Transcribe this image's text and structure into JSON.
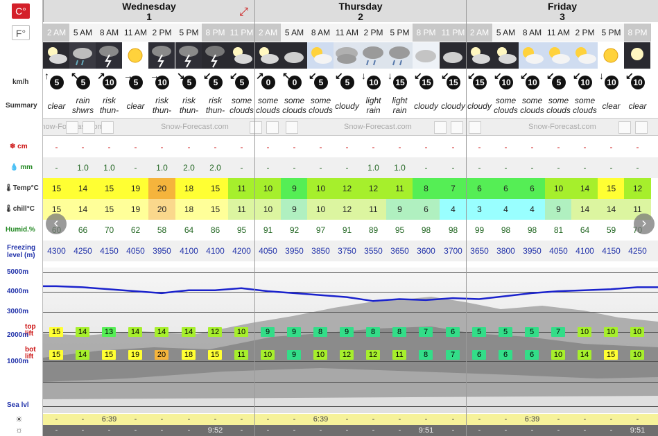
{
  "units": {
    "celsius": "C°",
    "fahrenheit": "F°"
  },
  "row_labels": {
    "speed": "km/h",
    "summary": "Summary",
    "snow": "cm",
    "rain": "mm",
    "temp": "Temp°C",
    "chill": "chill°C",
    "humid": "Humid.%",
    "freezing_1": "Freezing",
    "freezing_2": "level (m)",
    "alt_5000": "5000m",
    "alt_4000": "4000m",
    "alt_3000": "3000m",
    "alt_2000": "2000m",
    "alt_1000": "1000m",
    "sea": "Sea lvl",
    "top_lift_1": "top",
    "top_lift_2": "lift",
    "bot_lift_1": "bot",
    "bot_lift_2": "lift"
  },
  "days": [
    {
      "name": "Wednesday",
      "num": "1"
    },
    {
      "name": "Thursday",
      "num": "2"
    },
    {
      "name": "Friday",
      "num": "3"
    }
  ],
  "times": [
    "2 AM",
    "5 AM",
    "8 AM",
    "11 AM",
    "2 PM",
    "5 PM",
    "8 PM",
    "11 PM",
    "2 AM",
    "5 AM",
    "8 AM",
    "11 AM",
    "2 PM",
    "5 PM",
    "8 PM",
    "11 PM",
    "2 AM",
    "5 AM",
    "8 AM",
    "11 AM",
    "2 PM",
    "5 PM",
    "8 PM"
  ],
  "night": [
    true,
    false,
    false,
    false,
    false,
    false,
    true,
    true,
    true,
    false,
    false,
    false,
    false,
    false,
    true,
    true,
    true,
    false,
    false,
    false,
    false,
    false,
    true
  ],
  "icons": [
    "moon-cloud",
    "rain-cloud",
    "thunder",
    "sun",
    "thunder",
    "thunder",
    "thunder-night",
    "moon-cloud",
    "moon-cloud",
    "cloud-night",
    "sun-cloud",
    "heavy-cloud",
    "rain-cloud-day",
    "rain-cloud-day",
    "cloud",
    "cloud-night",
    "moon-cloud",
    "moon-cloud",
    "sun-cloud",
    "sun-cloud",
    "sun-cloud",
    "sun",
    "moon"
  ],
  "wind_speed": [
    "5",
    "5",
    "10",
    "5",
    "10",
    "5",
    "5",
    "5",
    "0",
    "0",
    "5",
    "5",
    "10",
    "15",
    "15",
    "15",
    "15",
    "10",
    "10",
    "5",
    "10",
    "10",
    "10"
  ],
  "wind_dir": [
    "↑",
    "↖",
    "↗",
    "→",
    "→",
    "↘",
    "↙",
    "↙",
    "↗",
    "↖",
    "↙",
    "↙",
    "↓",
    "↓",
    "↙",
    "↙",
    "↙",
    "↙",
    "↙",
    "↙",
    "↙",
    "↓",
    "↙"
  ],
  "summary": [
    [
      "clear"
    ],
    [
      "rain",
      "shwrs"
    ],
    [
      "risk",
      "thun-"
    ],
    [
      "clear"
    ],
    [
      "risk",
      "thun-"
    ],
    [
      "risk",
      "thun-"
    ],
    [
      "risk",
      "thun-"
    ],
    [
      "some",
      "clouds"
    ],
    [
      "some",
      "clouds"
    ],
    [
      "some",
      "clouds"
    ],
    [
      "some",
      "clouds"
    ],
    [
      "cloudy"
    ],
    [
      "light",
      "rain"
    ],
    [
      "light",
      "rain"
    ],
    [
      "cloudy"
    ],
    [
      "cloudy"
    ],
    [
      "cloudy"
    ],
    [
      "some",
      "clouds"
    ],
    [
      "some",
      "clouds"
    ],
    [
      "some",
      "clouds"
    ],
    [
      "some",
      "clouds"
    ],
    [
      "clear"
    ],
    [
      "clear"
    ]
  ],
  "ad_text": "Snow-Forecast.com",
  "snow": [
    "-",
    "-",
    "-",
    "-",
    "-",
    "-",
    "-",
    "-",
    "-",
    "-",
    "-",
    "-",
    "-",
    "-",
    "-",
    "-",
    "-",
    "-",
    "-",
    "-",
    "-",
    "-",
    "-"
  ],
  "rain": [
    "-",
    "1.0",
    "1.0",
    "-",
    "1.0",
    "2.0",
    "2.0",
    "-",
    "-",
    "-",
    "-",
    "-",
    "1.0",
    "1.0",
    "-",
    "-",
    "-",
    "-",
    "-",
    "-",
    "-",
    "-",
    "-"
  ],
  "temp": [
    "15",
    "14",
    "15",
    "19",
    "20",
    "18",
    "15",
    "11",
    "10",
    "9",
    "10",
    "12",
    "12",
    "11",
    "8",
    "7",
    "6",
    "6",
    "6",
    "10",
    "14",
    "15",
    "12"
  ],
  "temp_colors": [
    "#ffff33",
    "#ffff33",
    "#ffff33",
    "#ffff33",
    "#f5b43c",
    "#ffff33",
    "#ffff33",
    "#a6ef2c",
    "#a6ef2c",
    "#55ee55",
    "#a6ef2c",
    "#a6ef2c",
    "#a6ef2c",
    "#a6ef2c",
    "#55ee55",
    "#55ee55",
    "#55ee55",
    "#55ee55",
    "#55ee55",
    "#a6ef2c",
    "#a6ef2c",
    "#ffff33",
    "#a6ef2c"
  ],
  "chill": [
    "15",
    "14",
    "15",
    "19",
    "20",
    "18",
    "15",
    "11",
    "10",
    "9",
    "10",
    "12",
    "11",
    "9",
    "6",
    "4",
    "3",
    "4",
    "4",
    "9",
    "14",
    "14",
    "11"
  ],
  "chill_colors": [
    "#ffff99",
    "#ffff99",
    "#ffff99",
    "#ffff99",
    "#fad88c",
    "#ffff99",
    "#ffff99",
    "#dcf5a0",
    "#dcf5a0",
    "#b0f0c0",
    "#dcf5a0",
    "#dcf5a0",
    "#dcf5a0",
    "#b0f0c0",
    "#b0f0c0",
    "#99ffff",
    "#99ffff",
    "#99ffff",
    "#99ffff",
    "#b0f0c0",
    "#dcf5a0",
    "#dcf5a0",
    "#dcf5a0"
  ],
  "humid": [
    "60",
    "66",
    "70",
    "62",
    "58",
    "64",
    "86",
    "95",
    "91",
    "92",
    "97",
    "91",
    "89",
    "95",
    "98",
    "98",
    "99",
    "98",
    "98",
    "81",
    "64",
    "59",
    "70"
  ],
  "freezing": [
    "4300",
    "4250",
    "4150",
    "4050",
    "3950",
    "4100",
    "4100",
    "4200",
    "4050",
    "3950",
    "3850",
    "3750",
    "3550",
    "3650",
    "3600",
    "3700",
    "3650",
    "3800",
    "3950",
    "4050",
    "4100",
    "4150",
    "4250"
  ],
  "top_lift": [
    "15",
    "14",
    "13",
    "14",
    "14",
    "14",
    "12",
    "10",
    "9",
    "9",
    "8",
    "9",
    "8",
    "8",
    "7",
    "6",
    "5",
    "5",
    "5",
    "7",
    "10",
    "10",
    "10"
  ],
  "top_lift_colors": [
    "#ffff33",
    "#a6ef2c",
    "#55ee55",
    "#a6ef2c",
    "#a6ef2c",
    "#a6ef2c",
    "#a6ef2c",
    "#a6ef2c",
    "#33dd88",
    "#33dd88",
    "#33dd88",
    "#33dd88",
    "#33dd88",
    "#33dd88",
    "#33dd88",
    "#33dd88",
    "#33dd88",
    "#33dd88",
    "#33dd88",
    "#33dd88",
    "#a6ef2c",
    "#a6ef2c",
    "#a6ef2c"
  ],
  "bot_lift": [
    "15",
    "14",
    "15",
    "19",
    "20",
    "18",
    "15",
    "11",
    "10",
    "9",
    "10",
    "12",
    "12",
    "11",
    "8",
    "7",
    "6",
    "6",
    "6",
    "10",
    "14",
    "15",
    "10"
  ],
  "bot_lift_colors": [
    "#ffff33",
    "#a6ef2c",
    "#ffff33",
    "#ffff33",
    "#f5b43c",
    "#ffff33",
    "#ffff33",
    "#a6ef2c",
    "#a6ef2c",
    "#33dd88",
    "#a6ef2c",
    "#a6ef2c",
    "#a6ef2c",
    "#a6ef2c",
    "#33dd88",
    "#33dd88",
    "#33dd88",
    "#33dd88",
    "#33dd88",
    "#a6ef2c",
    "#a6ef2c",
    "#ffff33",
    "#a6ef2c"
  ],
  "sunrise": [
    "-",
    "-",
    "6:39",
    "-",
    "-",
    "-",
    "-",
    "-",
    "-",
    "-",
    "6:39",
    "-",
    "-",
    "-",
    "-",
    "-",
    "-",
    "-",
    "6:39",
    "-",
    "-",
    "-",
    "-"
  ],
  "sunset": [
    "-",
    "-",
    "-",
    "-",
    "-",
    "-",
    "9:52",
    "-",
    "-",
    "-",
    "-",
    "-",
    "-",
    "-",
    "9:51",
    "-",
    "-",
    "-",
    "-",
    "-",
    "-",
    "-",
    "9:51"
  ]
}
